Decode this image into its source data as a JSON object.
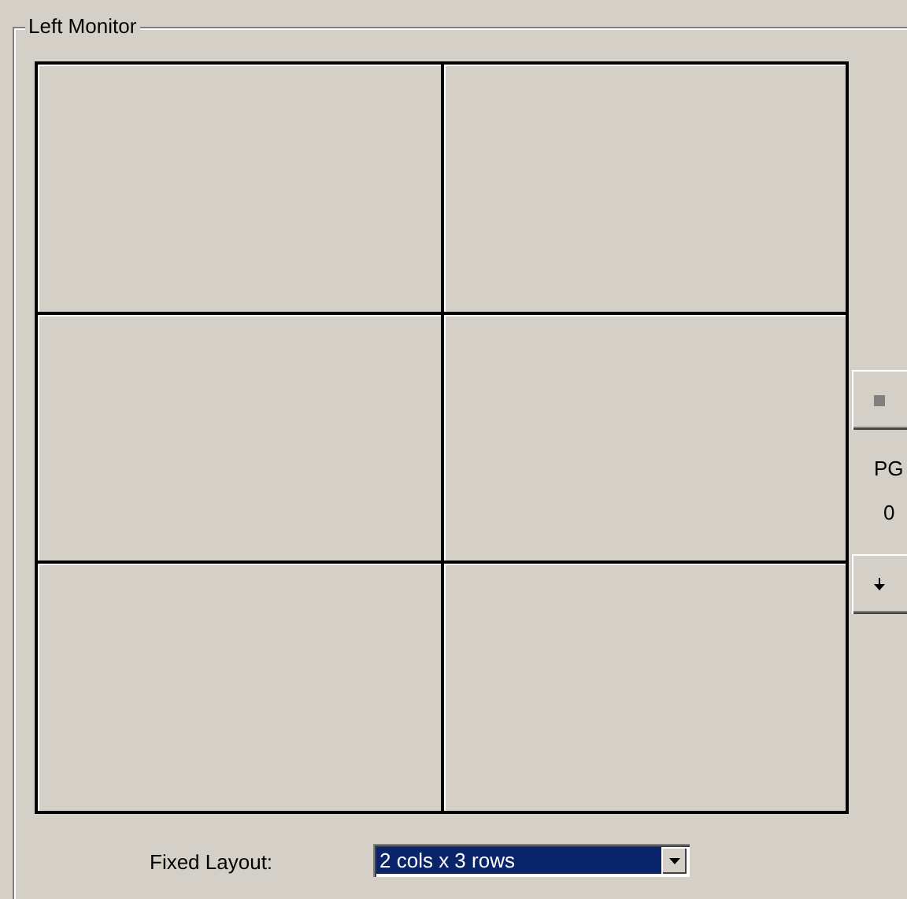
{
  "group": {
    "title": "Left Monitor"
  },
  "pager": {
    "label": "PG",
    "page": "0"
  },
  "layout": {
    "label": "Fixed Layout:",
    "value": "2 cols x 3 rows"
  }
}
